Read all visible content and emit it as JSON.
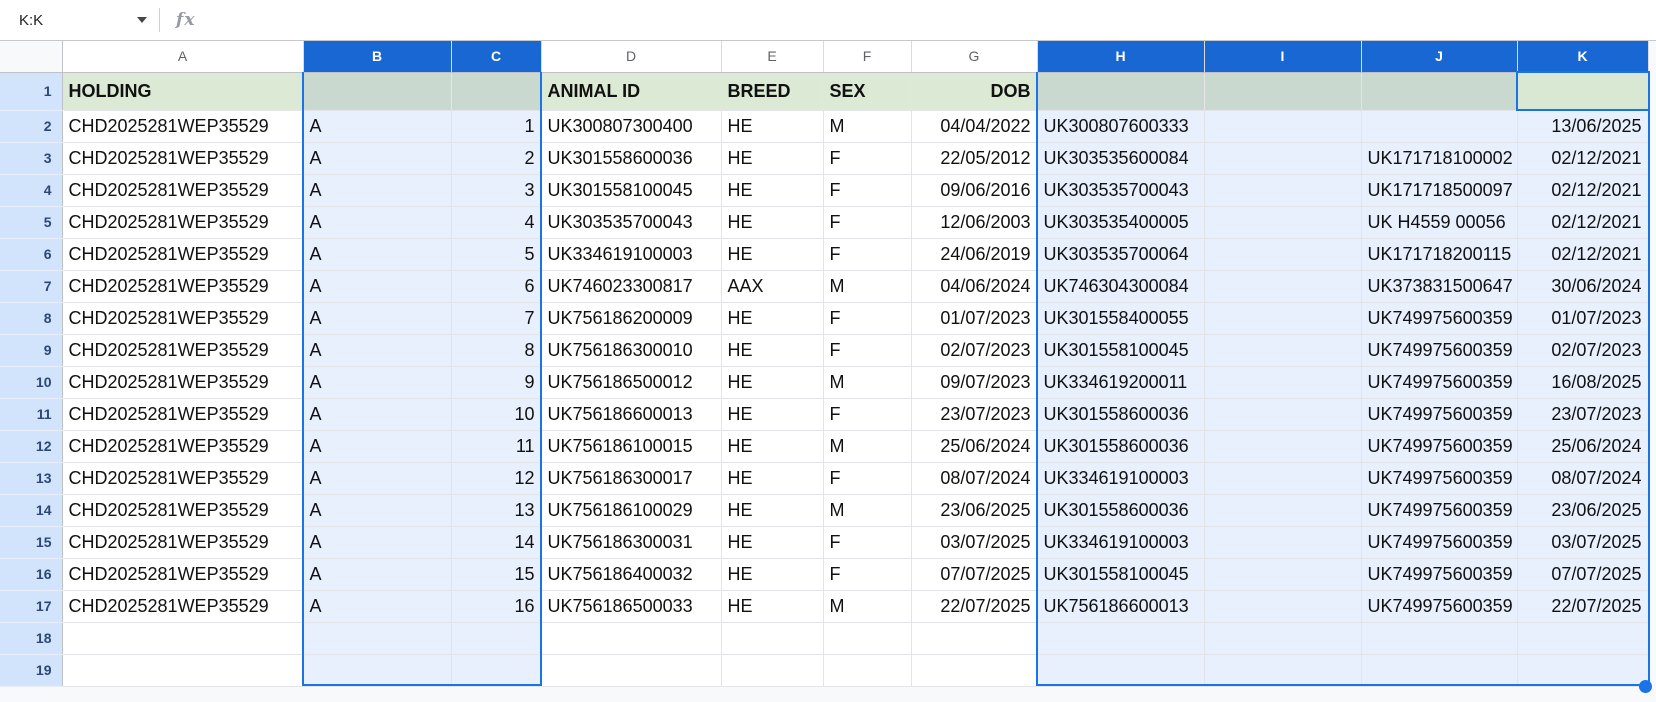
{
  "formula_bar": {
    "name_box_value": "K:K",
    "fx_label": "fx"
  },
  "grid": {
    "columns": [
      {
        "letter": "A",
        "selected": false
      },
      {
        "letter": "B",
        "selected": true
      },
      {
        "letter": "C",
        "selected": true
      },
      {
        "letter": "D",
        "selected": false
      },
      {
        "letter": "E",
        "selected": false
      },
      {
        "letter": "F",
        "selected": false
      },
      {
        "letter": "G",
        "selected": false
      },
      {
        "letter": "H",
        "selected": true
      },
      {
        "letter": "I",
        "selected": true
      },
      {
        "letter": "J",
        "selected": true
      },
      {
        "letter": "K",
        "selected": true
      }
    ],
    "selection": {
      "ranges": [
        "B:C",
        "H:K"
      ],
      "active_cell": "K1"
    },
    "header_row": {
      "n": 1,
      "A": "HOLDING",
      "B": "",
      "C": "",
      "D": "ANIMAL ID",
      "E": "BREED",
      "F": "SEX",
      "G": "DOB",
      "H": "",
      "I": "",
      "J": "",
      "K": ""
    },
    "rows": [
      {
        "n": 2,
        "A": "CHD2025281WEP35529",
        "B": "A",
        "C": "1",
        "D": "UK300807300400",
        "E": "HE",
        "F": "M",
        "G": "04/04/2022",
        "H": "UK300807600333",
        "I": "",
        "J": "",
        "K": "13/06/2025"
      },
      {
        "n": 3,
        "A": "CHD2025281WEP35529",
        "B": "A",
        "C": "2",
        "D": "UK301558600036",
        "E": "HE",
        "F": "F",
        "G": "22/05/2012",
        "H": "UK303535600084",
        "I": "",
        "J": "UK171718100002",
        "K": "02/12/2021"
      },
      {
        "n": 4,
        "A": "CHD2025281WEP35529",
        "B": "A",
        "C": "3",
        "D": "UK301558100045",
        "E": "HE",
        "F": "F",
        "G": "09/06/2016",
        "H": "UK303535700043",
        "I": "",
        "J": "UK171718500097",
        "K": "02/12/2021"
      },
      {
        "n": 5,
        "A": "CHD2025281WEP35529",
        "B": "A",
        "C": "4",
        "D": "UK303535700043",
        "E": "HE",
        "F": "F",
        "G": "12/06/2003",
        "H": "UK303535400005",
        "I": "",
        "J": "UK H4559 00056",
        "K": "02/12/2021"
      },
      {
        "n": 6,
        "A": "CHD2025281WEP35529",
        "B": "A",
        "C": "5",
        "D": "UK334619100003",
        "E": "HE",
        "F": "F",
        "G": "24/06/2019",
        "H": "UK303535700064",
        "I": "",
        "J": "UK171718200115",
        "K": "02/12/2021"
      },
      {
        "n": 7,
        "A": "CHD2025281WEP35529",
        "B": "A",
        "C": "6",
        "D": "UK746023300817",
        "E": "AAX",
        "F": "M",
        "G": "04/06/2024",
        "H": "UK746304300084",
        "I": "",
        "J": "UK373831500647",
        "K": "30/06/2024"
      },
      {
        "n": 8,
        "A": "CHD2025281WEP35529",
        "B": "A",
        "C": "7",
        "D": "UK756186200009",
        "E": "HE",
        "F": "F",
        "G": "01/07/2023",
        "H": "UK301558400055",
        "I": "",
        "J": "UK749975600359",
        "K": "01/07/2023"
      },
      {
        "n": 9,
        "A": "CHD2025281WEP35529",
        "B": "A",
        "C": "8",
        "D": "UK756186300010",
        "E": "HE",
        "F": "F",
        "G": "02/07/2023",
        "H": "UK301558100045",
        "I": "",
        "J": "UK749975600359",
        "K": "02/07/2023"
      },
      {
        "n": 10,
        "A": "CHD2025281WEP35529",
        "B": "A",
        "C": "9",
        "D": "UK756186500012",
        "E": "HE",
        "F": "M",
        "G": "09/07/2023",
        "H": "UK334619200011",
        "I": "",
        "J": "UK749975600359",
        "K": "16/08/2025"
      },
      {
        "n": 11,
        "A": "CHD2025281WEP35529",
        "B": "A",
        "C": "10",
        "D": "UK756186600013",
        "E": "HE",
        "F": "F",
        "G": "23/07/2023",
        "H": "UK301558600036",
        "I": "",
        "J": "UK749975600359",
        "K": "23/07/2023"
      },
      {
        "n": 12,
        "A": "CHD2025281WEP35529",
        "B": "A",
        "C": "11",
        "D": "UK756186100015",
        "E": "HE",
        "F": "M",
        "G": "25/06/2024",
        "H": "UK301558600036",
        "I": "",
        "J": "UK749975600359",
        "K": "25/06/2024"
      },
      {
        "n": 13,
        "A": "CHD2025281WEP35529",
        "B": "A",
        "C": "12",
        "D": "UK756186300017",
        "E": "HE",
        "F": "F",
        "G": "08/07/2024",
        "H": "UK334619100003",
        "I": "",
        "J": "UK749975600359",
        "K": "08/07/2024"
      },
      {
        "n": 14,
        "A": "CHD2025281WEP35529",
        "B": "A",
        "C": "13",
        "D": "UK756186100029",
        "E": "HE",
        "F": "M",
        "G": "23/06/2025",
        "H": "UK301558600036",
        "I": "",
        "J": "UK749975600359",
        "K": "23/06/2025"
      },
      {
        "n": 15,
        "A": "CHD2025281WEP35529",
        "B": "A",
        "C": "14",
        "D": "UK756186300031",
        "E": "HE",
        "F": "F",
        "G": "03/07/2025",
        "H": "UK334619100003",
        "I": "",
        "J": "UK749975600359",
        "K": "03/07/2025"
      },
      {
        "n": 16,
        "A": "CHD2025281WEP35529",
        "B": "A",
        "C": "15",
        "D": "UK756186400032",
        "E": "HE",
        "F": "F",
        "G": "07/07/2025",
        "H": "UK301558100045",
        "I": "",
        "J": "UK749975600359",
        "K": "07/07/2025"
      },
      {
        "n": 17,
        "A": "CHD2025281WEP35529",
        "B": "A",
        "C": "16",
        "D": "UK756186500033",
        "E": "HE",
        "F": "M",
        "G": "22/07/2025",
        "H": "UK756186600013",
        "I": "",
        "J": "UK749975600359",
        "K": "22/07/2025"
      }
    ],
    "trailing_empty_rows": [
      18,
      19
    ]
  },
  "colors": {
    "accent": "#1a73e8",
    "selected_column_header": "#1967d2",
    "header_row_green": "#dbe9d5",
    "header_row_green_selected": "#c9d9d0",
    "selected_cell_tint": "#e8effd",
    "row_header_bg": "#d2e3fc"
  }
}
